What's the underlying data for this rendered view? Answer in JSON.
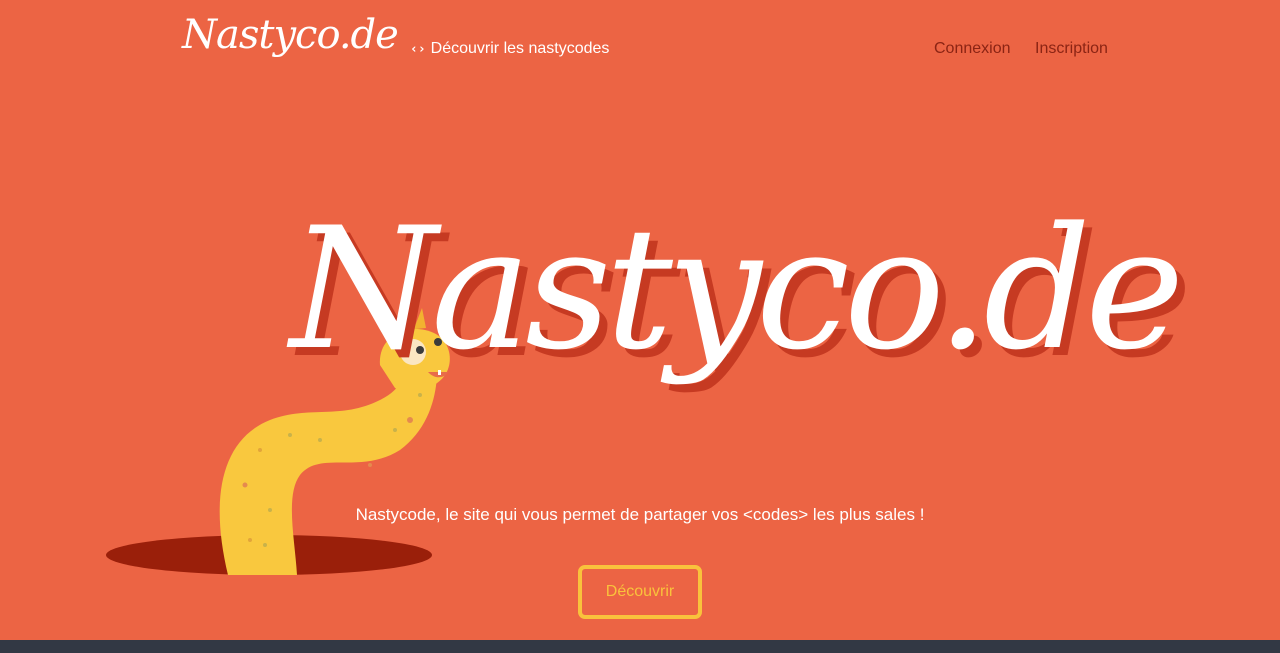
{
  "nav": {
    "logo": "Nastyco.de",
    "discover_icon": "‹›",
    "discover_label": "Découvrir les nastycodes",
    "login": "Connexion",
    "signup": "Inscription"
  },
  "hero": {
    "title": "Nastyco.de",
    "tagline": "Nastycode, le site qui vous permet de partager vos <codes> les plus sales !",
    "cta": "Découvrir"
  },
  "colors": {
    "background": "#EC6444",
    "nav_dark_link": "#8B2414",
    "accent": "#F9C23C",
    "title_shadow": "#C63A22",
    "hole": "#9A1F0A",
    "footer": "#323844"
  },
  "icons": {
    "discover_icon": "code-icon",
    "mascot": "worm-mascot"
  }
}
